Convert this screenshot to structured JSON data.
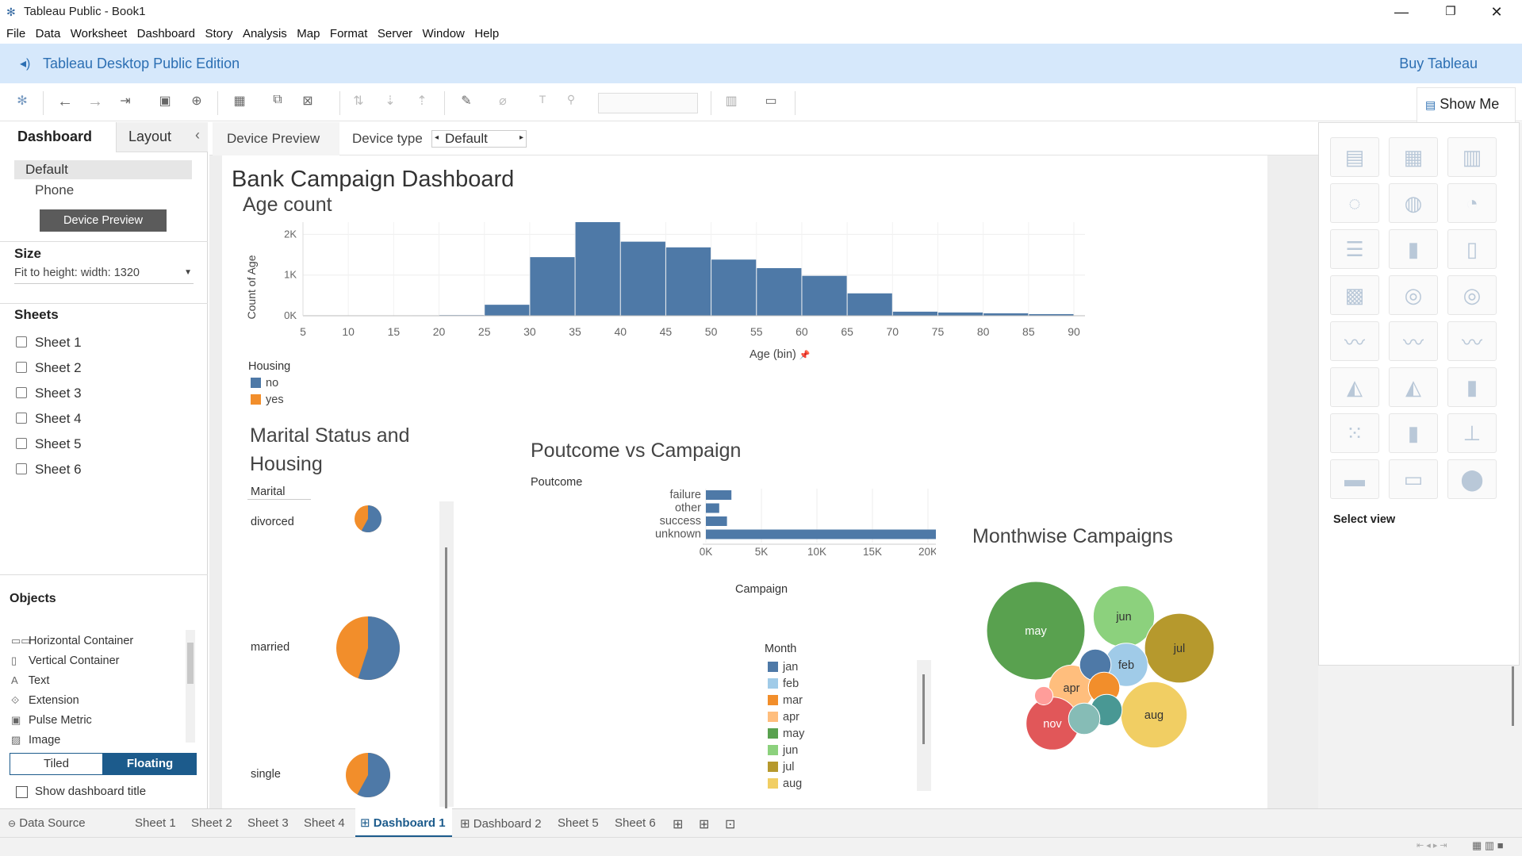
{
  "window": {
    "title": "Tableau Public - Book1",
    "min": "—",
    "restore": "❐",
    "close": "✕"
  },
  "menu": [
    "File",
    "Data",
    "Worksheet",
    "Dashboard",
    "Story",
    "Analysis",
    "Map",
    "Format",
    "Server",
    "Window",
    "Help"
  ],
  "banner": {
    "title": "Tableau Desktop Public Edition",
    "buy": "Buy Tableau"
  },
  "toolbar": {
    "show_me": "Show Me"
  },
  "left_panel": {
    "tab_dashboard": "Dashboard",
    "tab_layout": "Layout",
    "collapse": "‹",
    "devices": [
      "Default",
      "Phone"
    ],
    "device_preview_button": "Device Preview",
    "size_label": "Size",
    "size_value": "Fit to height: width: 1320",
    "sheets_label": "Sheets",
    "sheets": [
      "Sheet 1",
      "Sheet 2",
      "Sheet 3",
      "Sheet 4",
      "Sheet 5",
      "Sheet 6"
    ],
    "objects_label": "Objects",
    "objects": [
      {
        "icon": "▭▭",
        "label": "Horizontal Container"
      },
      {
        "icon": "▯",
        "label": "Vertical Container"
      },
      {
        "icon": "A",
        "label": "Text"
      },
      {
        "icon": "⟐",
        "label": "Extension"
      },
      {
        "icon": "▣",
        "label": "Pulse Metric"
      },
      {
        "icon": "▨",
        "label": "Image"
      }
    ],
    "tiled": "Tiled",
    "floating": "Floating",
    "show_title": "Show dashboard title"
  },
  "device_bar": {
    "preview": "Device Preview",
    "type_label": "Device type",
    "type_value": "Default"
  },
  "dashboard": {
    "title": "Bank Campaign Dashboard",
    "age_title": "Age count",
    "marital_title_1": "Marital Status and",
    "marital_title_2": "Housing",
    "marital_header": "Marital",
    "poutcome_title": "Poutcome vs Campaign",
    "poutcome_header": "Poutcome",
    "month_title": "Monthwise Campaigns",
    "housing_legend_title": "Housing",
    "month_legend_title": "Month",
    "pin": "📌"
  },
  "chart_data": [
    {
      "type": "bar",
      "title": "Age count",
      "xlabel": "Age (bin)",
      "ylabel": "Count of Age",
      "x_ticks": [
        "5",
        "10",
        "15",
        "20",
        "25",
        "30",
        "35",
        "40",
        "45",
        "50",
        "55",
        "60",
        "65",
        "70",
        "75",
        "80",
        "85",
        "90"
      ],
      "y_ticks": [
        "0K",
        "1K",
        "2K"
      ],
      "ylim": [
        0,
        2300
      ],
      "bins": [
        17,
        20,
        25,
        30,
        35,
        40,
        45,
        50,
        55,
        60,
        65,
        70,
        75,
        80,
        85
      ],
      "values": [
        10,
        15,
        270,
        1440,
        2320,
        1820,
        1680,
        1380,
        1170,
        980,
        550,
        100,
        80,
        60,
        40
      ],
      "series_name_field": "Housing",
      "legend": [
        {
          "name": "no",
          "color": "#4e79a7"
        },
        {
          "name": "yes",
          "color": "#f28e2b"
        }
      ]
    },
    {
      "type": "pie",
      "title": "Marital Status and Housing",
      "rows": [
        {
          "label": "divorced",
          "no": 0.58,
          "yes": 0.42,
          "size": 34
        },
        {
          "label": "married",
          "no": 0.55,
          "yes": 0.45,
          "size": 80
        },
        {
          "label": "single",
          "no": 0.58,
          "yes": 0.42,
          "size": 56
        }
      ]
    },
    {
      "type": "bar",
      "orientation": "horizontal",
      "title": "Poutcome vs Campaign",
      "xlabel": "Campaign",
      "ylabel": "Poutcome",
      "categories": [
        "failure",
        "other",
        "success",
        "unknown"
      ],
      "values": [
        2300,
        1200,
        1900,
        22600
      ],
      "x_ticks": [
        "0K",
        "5K",
        "10K",
        "15K",
        "20K"
      ],
      "xlim": [
        0,
        25000
      ]
    },
    {
      "type": "bubble",
      "title": "Monthwise Campaigns",
      "items": [
        {
          "label": "may",
          "color": "#59a14f",
          "size": 13766
        },
        {
          "label": "jun",
          "color": "#8cd17d",
          "size": 5341
        },
        {
          "label": "jul",
          "color": "#b6992d",
          "size": 6895
        },
        {
          "label": "feb",
          "color": "#a0cbe8",
          "size": 2649
        },
        {
          "label": "apr",
          "color": "#ffbe7d",
          "size": 2932
        },
        {
          "label": "aug",
          "color": "#f1ce63",
          "size": 6247
        },
        {
          "label": "nov",
          "color": "#e15759",
          "size": 3970
        },
        {
          "label": "",
          "color": "#4e79a7",
          "size": 1403
        },
        {
          "label": "",
          "color": "#f28e2b",
          "size": 1403
        },
        {
          "label": "",
          "color": "#499894",
          "size": 1403
        },
        {
          "label": "",
          "color": "#86bcb6",
          "size": 1403
        },
        {
          "label": "",
          "color": "#ff9d9a",
          "size": 479
        }
      ],
      "legend": [
        {
          "name": "jan",
          "color": "#4e79a7"
        },
        {
          "name": "feb",
          "color": "#a0cbe8"
        },
        {
          "name": "mar",
          "color": "#f28e2b"
        },
        {
          "name": "apr",
          "color": "#ffbe7d"
        },
        {
          "name": "may",
          "color": "#59a14f"
        },
        {
          "name": "jun",
          "color": "#8cd17d"
        },
        {
          "name": "jul",
          "color": "#b6992d"
        },
        {
          "name": "aug",
          "color": "#f1ce63"
        }
      ]
    }
  ],
  "show_me_panel": {
    "select_view": "Select view",
    "icons": [
      "text-table",
      "heat-map",
      "highlight-table",
      "symbol-map",
      "filled-map",
      "pie",
      "hbar",
      "stacked-bar",
      "side-by-side-bar",
      "treemap",
      "circle-view",
      "side-by-side-circle",
      "line-continuous",
      "line-discrete",
      "dual-line",
      "area-continuous",
      "area-discrete",
      "dual-combination",
      "scatter",
      "histogram",
      "box-whisker",
      "gantt",
      "bullet",
      "packed-bubbles"
    ]
  },
  "bottom_tabs": {
    "data_source": "Data Source",
    "tabs": [
      "Sheet 1",
      "Sheet 2",
      "Sheet 3",
      "Sheet 4",
      "Dashboard 1",
      "Dashboard 2",
      "Sheet 5",
      "Sheet 6"
    ],
    "active": "Dashboard 1"
  },
  "colors": {
    "blue": "#4e79a7",
    "orange": "#f28e2b",
    "banner": "#d6e8fb",
    "floating": "#1c5b8c"
  }
}
